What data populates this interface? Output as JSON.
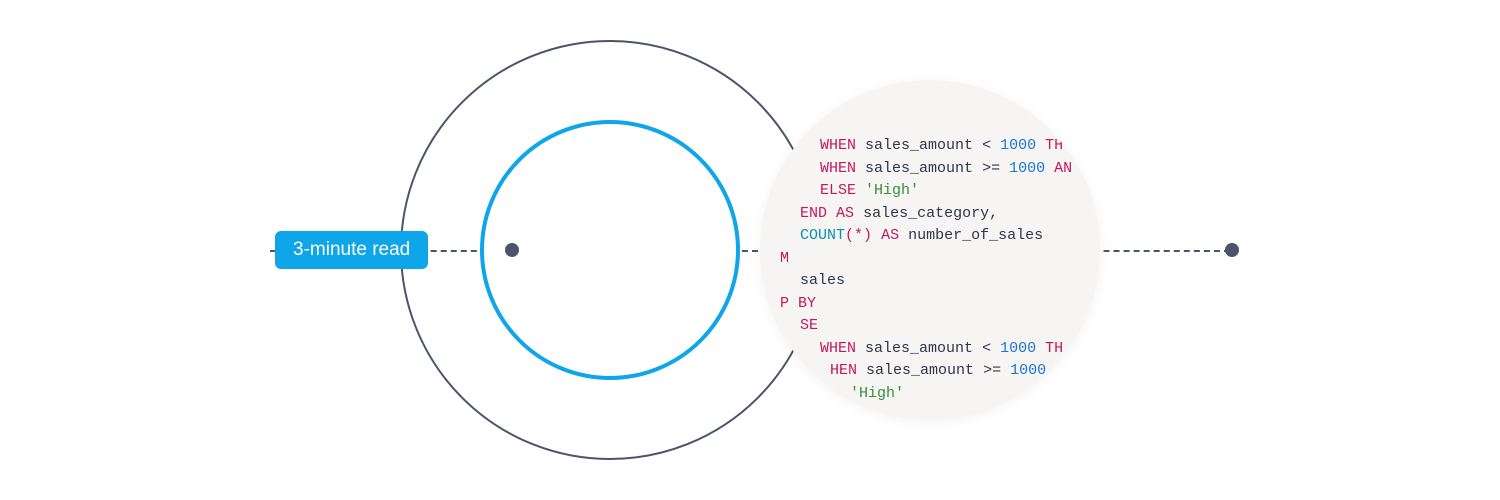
{
  "badge": {
    "text": "3-minute read"
  },
  "code": {
    "line1_when": "WHEN",
    "line1_ident": "sales_amount",
    "line1_op": "<",
    "line1_num": "1000",
    "line1_then": "TH",
    "line2_when": "WHEN",
    "line2_ident": "sales_amount",
    "line2_op": ">=",
    "line2_num": "1000",
    "line2_and": "AN",
    "line3_else": "ELSE",
    "line3_str": "'High'",
    "line4_end": "END",
    "line4_as": "AS",
    "line4_ident": "sales_category,",
    "line5_count": "COUNT",
    "line5_paren_open": "(",
    "line5_star": "*",
    "line5_paren_close": ")",
    "line5_as": "AS",
    "line5_ident": "number_of_sales",
    "line6_frag": "M",
    "line7_ident": "sales",
    "line8_frag": "P BY",
    "line9_frag": "SE",
    "line10_when": "WHEN",
    "line10_ident": "sales_amount",
    "line10_op": "<",
    "line10_num": "1000",
    "line10_then": "TH",
    "line11_frag": "HEN",
    "line11_ident": "sales_amount",
    "line11_op": ">=",
    "line11_num": "1000",
    "line12_str": "'High'"
  }
}
